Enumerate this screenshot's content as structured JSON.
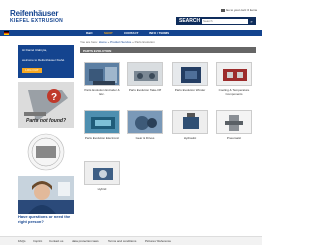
{
  "header": {
    "brand_line1": "Reifenhäuser",
    "brand_line2": "KIEFEL EXTRUSION",
    "cart_text": "Go to your cart: 0 items",
    "search_label": "SEARCH",
    "search_placeholder": "Search",
    "search_go": "»"
  },
  "nav": {
    "items": [
      "R&D",
      "SHOP",
      "CONTACT",
      "INFO / TERMS"
    ]
  },
  "sidebar": {
    "greeting": "Hi Daniel Ulabryta,",
    "welcome": "welcome to Reifenhäuser Kiefel.",
    "logout": "LOG OUT",
    "parts_text": "Parts not found?",
    "question": "Have questions or need the right person?"
  },
  "breadcrumb": {
    "prefix": "You are here:",
    "home": "Home",
    "sep1": "»",
    "cat": "Product Service",
    "sep2": "»",
    "current": "Parts Evolution"
  },
  "section": {
    "title": "PARTS EVOLUTION"
  },
  "tiles": [
    {
      "caption": "Parts Evolution Extruder & Etc."
    },
    {
      "caption": "Parts Evolution Take-Off"
    },
    {
      "caption": "Parts Evolution Winder"
    },
    {
      "caption": "Cooling & Temperature Components"
    },
    {
      "caption": "Parts Evolution Electronic"
    },
    {
      "caption": "Gear & Drives"
    },
    {
      "caption": "Hydraulic"
    },
    {
      "caption": "Pneumatic"
    },
    {
      "caption": "Hybrid"
    }
  ],
  "footer": {
    "links": [
      "FAQs",
      "Imprint",
      "Contact us",
      "data protection laws",
      "Terms and conditions",
      "Pictures' Reference"
    ]
  },
  "colors": {
    "brand_blue": "#14448f",
    "accent_orange": "#f6a821",
    "section_gray": "#666666"
  }
}
